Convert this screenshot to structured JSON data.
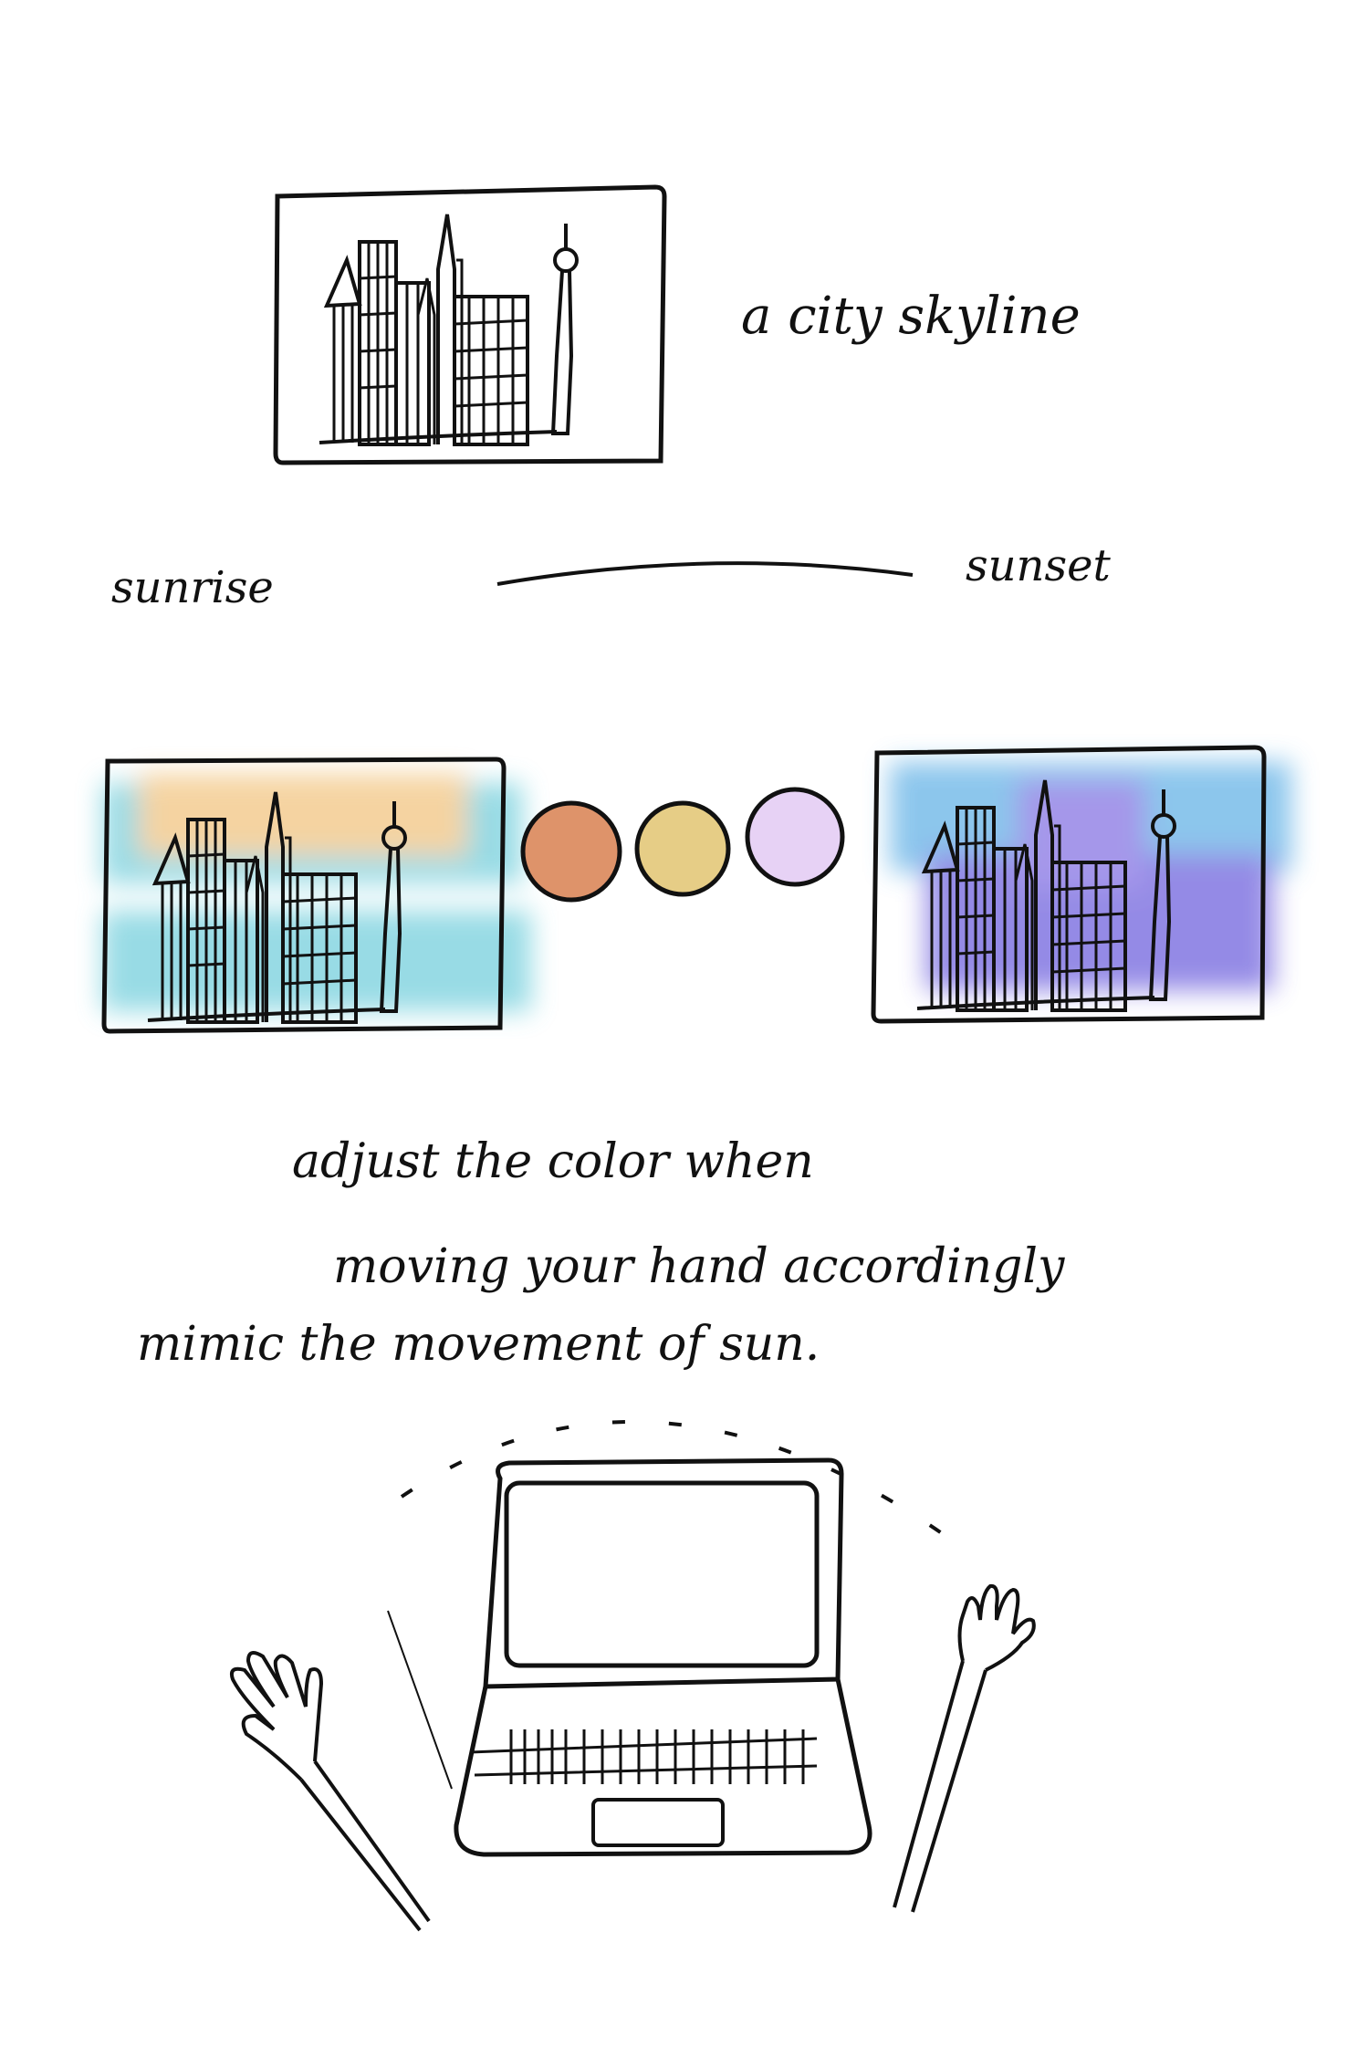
{
  "captions": {
    "skyline": "a city skyline",
    "sunrise": "sunrise",
    "sunset": "sunset",
    "instruction_line1": "adjust the color when",
    "instruction_line2": "moving your hand accordingly",
    "instruction_line3": "mimic the movement of sun."
  },
  "palette": [
    {
      "name": "orange-swatch",
      "color": "#de936a"
    },
    {
      "name": "yellow-swatch",
      "color": "#e6cd86"
    },
    {
      "name": "lilac-swatch",
      "color": "#e7d2f5"
    }
  ],
  "colors": {
    "ink": "#111111",
    "cyan_wash": "#7fd3df",
    "peach_wash": "#f3c98a",
    "purple_wash": "#7a6ee0",
    "blue_wash": "#6fb8e8"
  },
  "icons": [
    "city-skyline-sketch",
    "laptop-icon",
    "left-hand-icon",
    "right-hand-icon"
  ]
}
